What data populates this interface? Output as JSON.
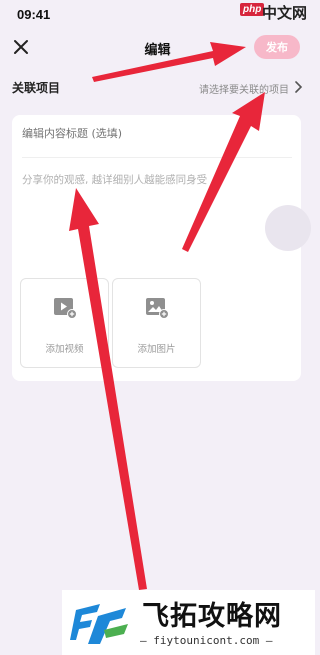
{
  "status_bar": {
    "time": "09:41"
  },
  "brand_badge": {
    "php": "php",
    "cn": "中文网"
  },
  "header": {
    "title": "编辑",
    "publish_label": "发布"
  },
  "related": {
    "label": "关联项目",
    "placeholder": "请选择要关联的项目"
  },
  "editor": {
    "title_placeholder": "编辑内容标题 (选填)",
    "content_placeholder": "分享你的观感, 越详细别人越能感同身受"
  },
  "media": {
    "video_label": "添加视频",
    "image_label": "添加图片"
  },
  "watermark": {
    "title": "飞拓攻略网",
    "subtitle": "— fiytounicont.com —"
  },
  "colors": {
    "accent": "#f7b8c9",
    "arrow": "#e8263a",
    "background": "#f3eff7"
  },
  "icons": {
    "close": "close-icon",
    "chevron": "chevron-right-icon",
    "video": "video-add-icon",
    "image": "image-add-icon"
  }
}
